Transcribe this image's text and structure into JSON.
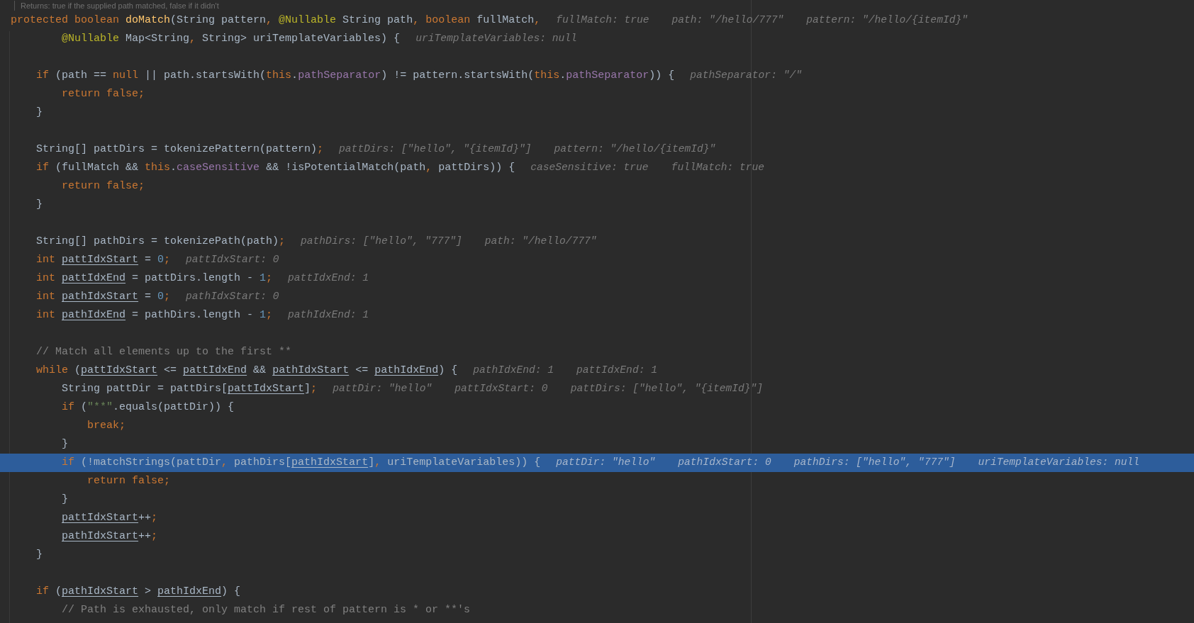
{
  "doc_comment": "Returns: true if the supplied path matched, false if it didn't",
  "lines": [
    {
      "kind": "code",
      "selected": false,
      "tokens": [
        {
          "kind": "kw",
          "text": "protected boolean "
        },
        {
          "kind": "decl",
          "text": "doMatch"
        },
        {
          "kind": "plain",
          "text": "(String pattern"
        },
        {
          "kind": "punct",
          "text": ", "
        },
        {
          "kind": "ann",
          "text": "@Nullable"
        },
        {
          "kind": "plain",
          "text": " String path"
        },
        {
          "kind": "punct",
          "text": ", "
        },
        {
          "kind": "kw",
          "text": "boolean "
        },
        {
          "kind": "plain",
          "text": "fullMatch"
        },
        {
          "kind": "punct",
          "text": ","
        }
      ],
      "hints": [
        "fullMatch: true",
        "path: \"/hello/777\"",
        "pattern: \"/hello/{itemId}\""
      ]
    },
    {
      "kind": "code",
      "selected": false,
      "tokens": [
        {
          "kind": "ann",
          "text": "        @Nullable"
        },
        {
          "kind": "plain",
          "text": " Map<String"
        },
        {
          "kind": "punct",
          "text": ", "
        },
        {
          "kind": "plain",
          "text": "String> uriTemplateVariables) {"
        }
      ],
      "hints": [
        "uriTemplateVariables: null"
      ]
    },
    {
      "kind": "blank"
    },
    {
      "kind": "code",
      "selected": false,
      "tokens": [
        {
          "kind": "kw",
          "text": "    if "
        },
        {
          "kind": "plain",
          "text": "(path == "
        },
        {
          "kind": "kw",
          "text": "null"
        },
        {
          "kind": "plain",
          "text": " || path.startsWith("
        },
        {
          "kind": "kw",
          "text": "this"
        },
        {
          "kind": "plain",
          "text": "."
        },
        {
          "kind": "field",
          "text": "pathSeparator"
        },
        {
          "kind": "plain",
          "text": ") != pattern.startsWith("
        },
        {
          "kind": "kw",
          "text": "this"
        },
        {
          "kind": "plain",
          "text": "."
        },
        {
          "kind": "field",
          "text": "pathSeparator"
        },
        {
          "kind": "plain",
          "text": ")) {"
        }
      ],
      "hints": [
        "pathSeparator: \"/\""
      ]
    },
    {
      "kind": "code",
      "selected": false,
      "tokens": [
        {
          "kind": "kw",
          "text": "        return false"
        },
        {
          "kind": "punct",
          "text": ";"
        }
      ]
    },
    {
      "kind": "code",
      "selected": false,
      "tokens": [
        {
          "kind": "plain",
          "text": "    }"
        }
      ]
    },
    {
      "kind": "blank"
    },
    {
      "kind": "code",
      "selected": false,
      "tokens": [
        {
          "kind": "plain",
          "text": "    String[] pattDirs = tokenizePattern(pattern)"
        },
        {
          "kind": "punct",
          "text": ";"
        }
      ],
      "hints": [
        "pattDirs: [\"hello\", \"{itemId}\"]",
        "pattern: \"/hello/{itemId}\""
      ]
    },
    {
      "kind": "code",
      "selected": false,
      "tokens": [
        {
          "kind": "kw",
          "text": "    if "
        },
        {
          "kind": "plain",
          "text": "(fullMatch && "
        },
        {
          "kind": "kw",
          "text": "this"
        },
        {
          "kind": "plain",
          "text": "."
        },
        {
          "kind": "field",
          "text": "caseSensitive"
        },
        {
          "kind": "plain",
          "text": " && !isPotentialMatch(path"
        },
        {
          "kind": "punct",
          "text": ", "
        },
        {
          "kind": "plain",
          "text": "pattDirs)) {"
        }
      ],
      "hints": [
        "caseSensitive: true",
        "fullMatch: true"
      ]
    },
    {
      "kind": "code",
      "selected": false,
      "tokens": [
        {
          "kind": "kw",
          "text": "        return false"
        },
        {
          "kind": "punct",
          "text": ";"
        }
      ]
    },
    {
      "kind": "code",
      "selected": false,
      "tokens": [
        {
          "kind": "plain",
          "text": "    }"
        }
      ]
    },
    {
      "kind": "blank"
    },
    {
      "kind": "code",
      "selected": false,
      "tokens": [
        {
          "kind": "plain",
          "text": "    String[] pathDirs = tokenizePath(path)"
        },
        {
          "kind": "punct",
          "text": ";"
        }
      ],
      "hints": [
        "pathDirs: [\"hello\", \"777\"]",
        "path: \"/hello/777\""
      ]
    },
    {
      "kind": "code",
      "selected": false,
      "tokens": [
        {
          "kind": "kw",
          "text": "    int "
        },
        {
          "kind": "var",
          "text": "pattIdxStart"
        },
        {
          "kind": "plain",
          "text": " = "
        },
        {
          "kind": "num",
          "text": "0"
        },
        {
          "kind": "punct",
          "text": ";"
        }
      ],
      "hints": [
        "pattIdxStart: 0"
      ]
    },
    {
      "kind": "code",
      "selected": false,
      "tokens": [
        {
          "kind": "kw",
          "text": "    int "
        },
        {
          "kind": "var",
          "text": "pattIdxEnd"
        },
        {
          "kind": "plain",
          "text": " = pattDirs.length - "
        },
        {
          "kind": "num",
          "text": "1"
        },
        {
          "kind": "punct",
          "text": ";"
        }
      ],
      "hints": [
        "pattIdxEnd: 1"
      ]
    },
    {
      "kind": "code",
      "selected": false,
      "tokens": [
        {
          "kind": "kw",
          "text": "    int "
        },
        {
          "kind": "var",
          "text": "pathIdxStart"
        },
        {
          "kind": "plain",
          "text": " = "
        },
        {
          "kind": "num",
          "text": "0"
        },
        {
          "kind": "punct",
          "text": ";"
        }
      ],
      "hints": [
        "pathIdxStart: 0"
      ]
    },
    {
      "kind": "code",
      "selected": false,
      "tokens": [
        {
          "kind": "kw",
          "text": "    int "
        },
        {
          "kind": "var",
          "text": "pathIdxEnd"
        },
        {
          "kind": "plain",
          "text": " = pathDirs.length - "
        },
        {
          "kind": "num",
          "text": "1"
        },
        {
          "kind": "punct",
          "text": ";"
        }
      ],
      "hints": [
        "pathIdxEnd: 1"
      ]
    },
    {
      "kind": "blank"
    },
    {
      "kind": "code",
      "selected": false,
      "tokens": [
        {
          "kind": "comment",
          "text": "    // Match all elements up to the first **"
        }
      ]
    },
    {
      "kind": "code",
      "selected": false,
      "tokens": [
        {
          "kind": "kw",
          "text": "    while "
        },
        {
          "kind": "plain",
          "text": "("
        },
        {
          "kind": "var",
          "text": "pattIdxStart"
        },
        {
          "kind": "plain",
          "text": " <= "
        },
        {
          "kind": "var",
          "text": "pattIdxEnd"
        },
        {
          "kind": "plain",
          "text": " && "
        },
        {
          "kind": "var",
          "text": "pathIdxStart"
        },
        {
          "kind": "plain",
          "text": " <= "
        },
        {
          "kind": "var",
          "text": "pathIdxEnd"
        },
        {
          "kind": "plain",
          "text": ") {"
        }
      ],
      "hints": [
        "pathIdxEnd: 1",
        "pattIdxEnd: 1"
      ]
    },
    {
      "kind": "code",
      "selected": false,
      "tokens": [
        {
          "kind": "plain",
          "text": "        String pattDir = pattDirs["
        },
        {
          "kind": "var",
          "text": "pattIdxStart"
        },
        {
          "kind": "plain",
          "text": "]"
        },
        {
          "kind": "punct",
          "text": ";"
        }
      ],
      "hints": [
        "pattDir: \"hello\"",
        "pattIdxStart: 0",
        "pattDirs: [\"hello\", \"{itemId}\"]"
      ]
    },
    {
      "kind": "code",
      "selected": false,
      "tokens": [
        {
          "kind": "kw",
          "text": "        if "
        },
        {
          "kind": "plain",
          "text": "("
        },
        {
          "kind": "str",
          "text": "\"**\""
        },
        {
          "kind": "plain",
          "text": ".equals(pattDir)) {"
        }
      ]
    },
    {
      "kind": "code",
      "selected": false,
      "tokens": [
        {
          "kind": "kw",
          "text": "            break"
        },
        {
          "kind": "punct",
          "text": ";"
        }
      ]
    },
    {
      "kind": "code",
      "selected": false,
      "tokens": [
        {
          "kind": "plain",
          "text": "        }"
        }
      ]
    },
    {
      "kind": "code",
      "selected": true,
      "tokens": [
        {
          "kind": "kw",
          "text": "        if "
        },
        {
          "kind": "plain",
          "text": "(!matchStrings(pattDir"
        },
        {
          "kind": "punct",
          "text": ", "
        },
        {
          "kind": "plain",
          "text": "pathDirs["
        },
        {
          "kind": "var",
          "text": "pathIdxStart"
        },
        {
          "kind": "plain",
          "text": "]"
        },
        {
          "kind": "punct",
          "text": ", "
        },
        {
          "kind": "plain",
          "text": "uriTemplateVariables)) {"
        }
      ],
      "hints": [
        "pattDir: \"hello\"",
        "pathIdxStart: 0",
        "pathDirs: [\"hello\", \"777\"]",
        "uriTemplateVariables: null"
      ]
    },
    {
      "kind": "code",
      "selected": false,
      "tokens": [
        {
          "kind": "kw",
          "text": "            return false"
        },
        {
          "kind": "punct",
          "text": ";"
        }
      ]
    },
    {
      "kind": "code",
      "selected": false,
      "tokens": [
        {
          "kind": "plain",
          "text": "        }"
        }
      ]
    },
    {
      "kind": "code",
      "selected": false,
      "tokens": [
        {
          "kind": "var",
          "text": "        pattIdxStart"
        },
        {
          "kind": "plain",
          "text": "++"
        },
        {
          "kind": "punct",
          "text": ";"
        }
      ]
    },
    {
      "kind": "code",
      "selected": false,
      "tokens": [
        {
          "kind": "var",
          "text": "        pathIdxStart"
        },
        {
          "kind": "plain",
          "text": "++"
        },
        {
          "kind": "punct",
          "text": ";"
        }
      ]
    },
    {
      "kind": "code",
      "selected": false,
      "tokens": [
        {
          "kind": "plain",
          "text": "    }"
        }
      ]
    },
    {
      "kind": "blank"
    },
    {
      "kind": "code",
      "selected": false,
      "tokens": [
        {
          "kind": "kw",
          "text": "    if "
        },
        {
          "kind": "plain",
          "text": "("
        },
        {
          "kind": "var",
          "text": "pathIdxStart"
        },
        {
          "kind": "plain",
          "text": " > "
        },
        {
          "kind": "var",
          "text": "pathIdxEnd"
        },
        {
          "kind": "plain",
          "text": ") {"
        }
      ]
    },
    {
      "kind": "code",
      "selected": false,
      "tokens": [
        {
          "kind": "comment",
          "text": "        // Path is exhausted, only match if rest of pattern is * or **'s"
        }
      ]
    }
  ]
}
